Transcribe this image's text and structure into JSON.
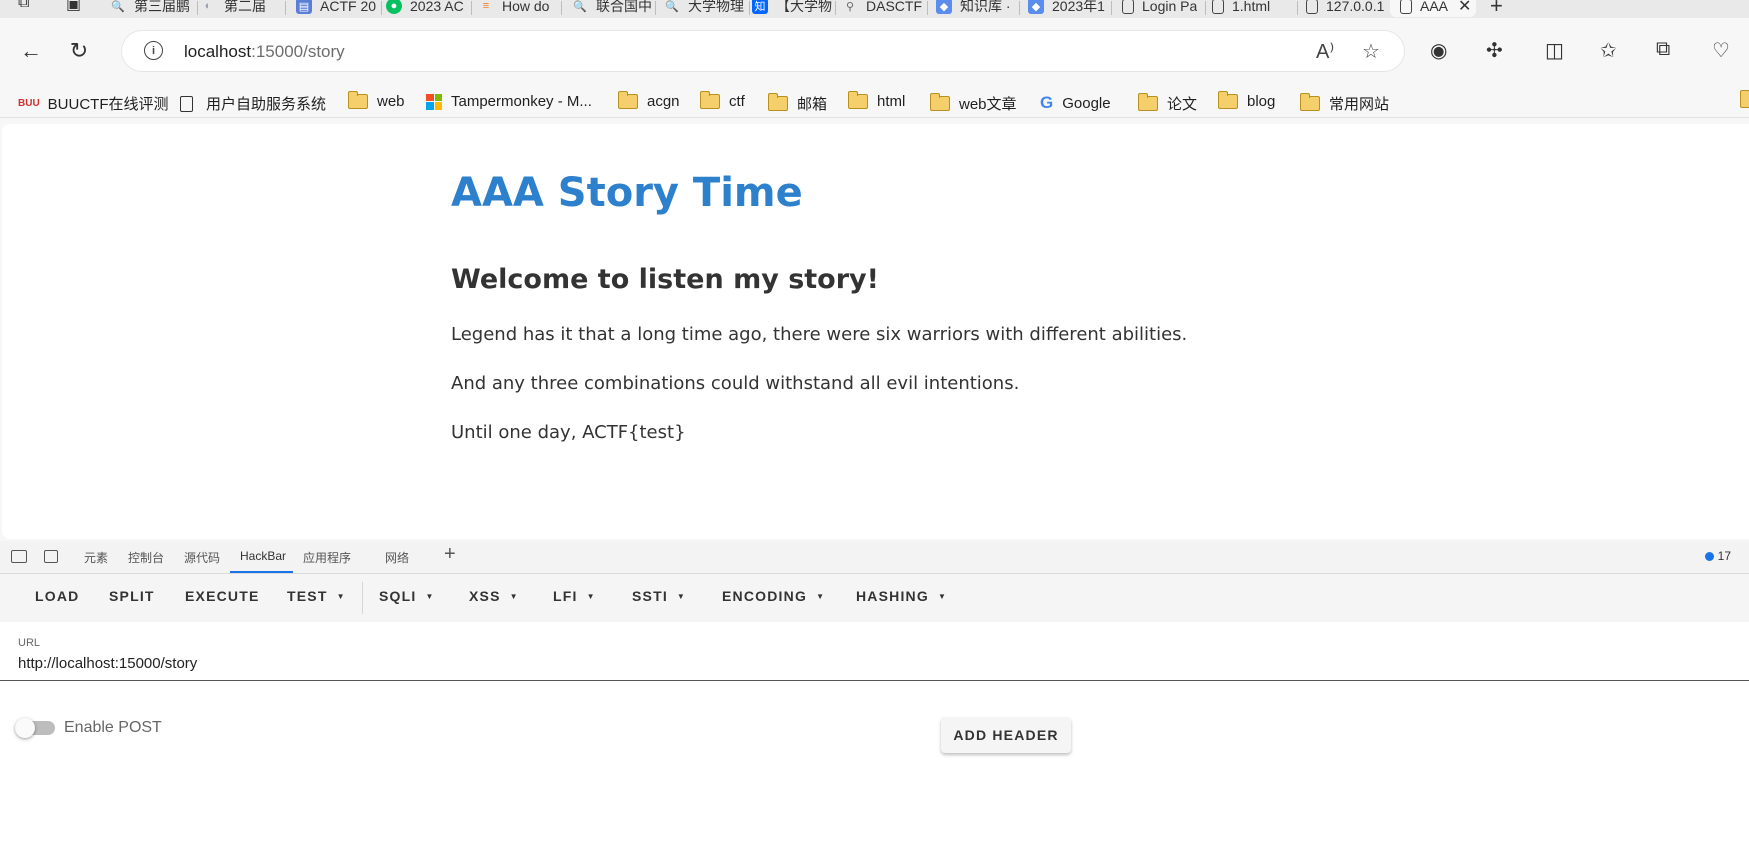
{
  "browser": {
    "tabs": [
      {
        "label": "第三届鹏",
        "color": "#4a8cf7",
        "glyph": "🔍"
      },
      {
        "label": "第二届",
        "color": "#9aa4b1",
        "glyph": "◐"
      },
      {
        "label": "ACTF 20",
        "color": "#5b7fd6",
        "glyph": "▤"
      },
      {
        "label": "2023 AC",
        "color": "#07c160",
        "glyph": "●"
      },
      {
        "label": "How do",
        "color": "#f48024",
        "glyph": "≡"
      },
      {
        "label": "联合国中",
        "color": "#4a8cf7",
        "glyph": "🔍"
      },
      {
        "label": "大学物理",
        "color": "#4a8cf7",
        "glyph": "🔍"
      },
      {
        "label": "【大学物",
        "color": "#0066ff",
        "glyph": "知"
      },
      {
        "label": "DASCTF",
        "color": "#666666",
        "glyph": "⚲"
      },
      {
        "label": "知识库 ·",
        "color": "#5a8dee",
        "glyph": "◆"
      },
      {
        "label": "2023年1",
        "color": "#5a8dee",
        "glyph": "◆"
      },
      {
        "label": "Login Pa",
        "color": "",
        "glyph": ""
      },
      {
        "label": "1.html",
        "color": "",
        "glyph": ""
      },
      {
        "label": "127.0.0.1",
        "color": "",
        "glyph": ""
      },
      {
        "label": "AAA",
        "color": "",
        "glyph": ""
      }
    ],
    "address": {
      "host": "localhost",
      "path": ":15000/story"
    },
    "bookmarks": [
      {
        "label": "BUUCTF在线评测",
        "icon": "buuctf-icon"
      },
      {
        "label": "用户自助服务系统",
        "icon": "page-icon"
      },
      {
        "label": "web",
        "icon": "folder-icon"
      },
      {
        "label": "Tampermonkey - M...",
        "icon": "microsoft-icon"
      },
      {
        "label": "acgn",
        "icon": "folder-icon"
      },
      {
        "label": "ctf",
        "icon": "folder-icon"
      },
      {
        "label": "邮箱",
        "icon": "folder-icon"
      },
      {
        "label": "html",
        "icon": "folder-icon"
      },
      {
        "label": "web文章",
        "icon": "folder-icon"
      },
      {
        "label": "Google",
        "icon": "google-icon"
      },
      {
        "label": "论文",
        "icon": "folder-icon"
      },
      {
        "label": "blog",
        "icon": "folder-icon"
      },
      {
        "label": "常用网站",
        "icon": "folder-icon"
      }
    ],
    "buuctf_glyph": "BUU",
    "google_glyph": "G"
  },
  "page": {
    "title": "AAA Story Time",
    "heading": "Welcome to listen my story!",
    "paragraphs": [
      "Legend has it that a long time ago, there were six warriors with different abilities.",
      "And any three combinations could withstand all evil intentions.",
      "Until one day, ACTF{test}"
    ]
  },
  "devtools": {
    "tabs": [
      "元素",
      "控制台",
      "源代码",
      "HackBar",
      "应用程序",
      "网络"
    ],
    "active_tab": "HackBar",
    "issues_count": "17",
    "accent": "#1a73e8"
  },
  "hackbar": {
    "menu": [
      {
        "label": "LOAD",
        "dropdown": false
      },
      {
        "label": "SPLIT",
        "dropdown": false
      },
      {
        "label": "EXECUTE",
        "dropdown": false
      },
      {
        "label": "TEST",
        "dropdown": true
      },
      {
        "label": "SQLI",
        "dropdown": true
      },
      {
        "label": "XSS",
        "dropdown": true
      },
      {
        "label": "LFI",
        "dropdown": true
      },
      {
        "label": "SSTI",
        "dropdown": true
      },
      {
        "label": "ENCODING",
        "dropdown": true
      },
      {
        "label": "HASHING",
        "dropdown": true
      }
    ],
    "url_label": "URL",
    "url_value": "http://localhost:15000/story",
    "enable_post_label": "Enable POST",
    "enable_post": false,
    "add_header_label": "ADD HEADER"
  }
}
